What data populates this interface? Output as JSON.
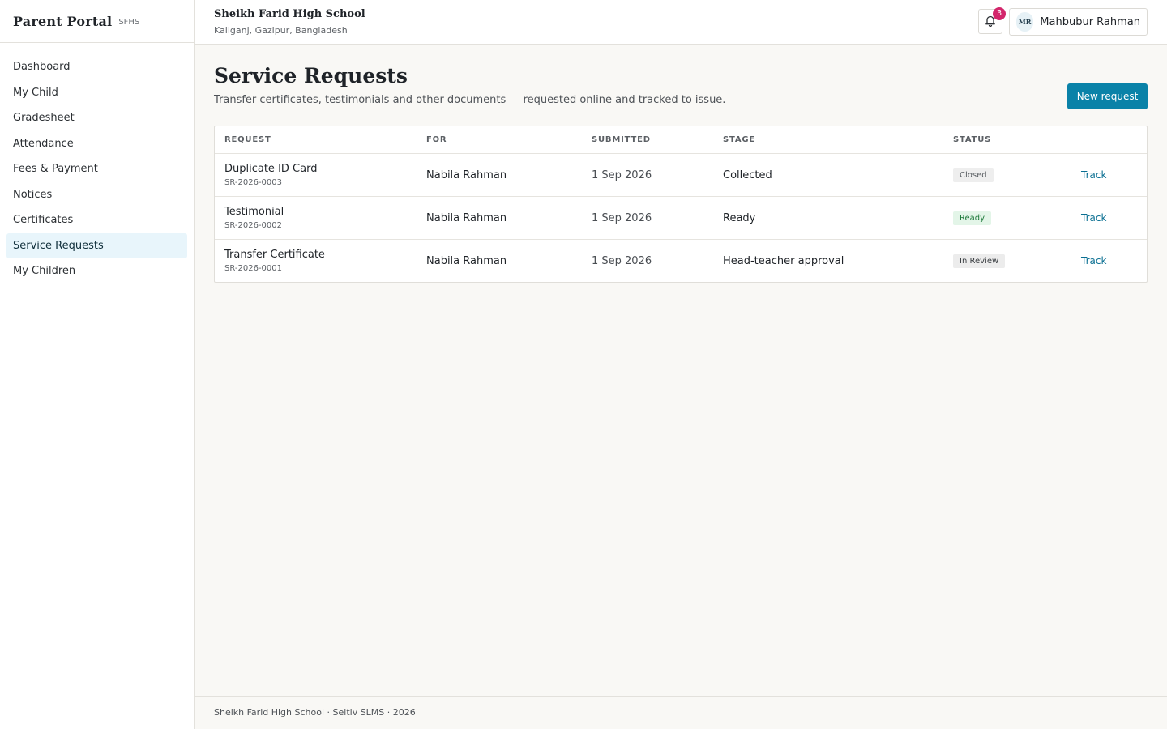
{
  "brand": {
    "title": "Parent Portal",
    "code": "SFHS"
  },
  "sidebar": {
    "items": [
      {
        "label": "Dashboard"
      },
      {
        "label": "My Child"
      },
      {
        "label": "Gradesheet"
      },
      {
        "label": "Attendance"
      },
      {
        "label": "Fees & Payment"
      },
      {
        "label": "Notices"
      },
      {
        "label": "Certificates"
      },
      {
        "label": "Service Requests",
        "active": true
      },
      {
        "label": "My Children"
      }
    ]
  },
  "header": {
    "school_name": "Sheikh Farid High School",
    "school_location": "Kaliganj, Gazipur, Bangladesh",
    "notification_count": "3",
    "user_initials": "MR",
    "user_name": "Mahbubur Rahman"
  },
  "page": {
    "title": "Service Requests",
    "subtitle": "Transfer certificates, testimonials and other documents — requested online and tracked to issue.",
    "new_request_label": "New request"
  },
  "table": {
    "columns": [
      "REQUEST",
      "FOR",
      "SUBMITTED",
      "STAGE",
      "STATUS"
    ],
    "rows": [
      {
        "request": "Duplicate ID Card",
        "id": "SR-2026-0003",
        "for": "Nabila Rahman",
        "submitted": "1 Sep 2026",
        "stage": "Collected",
        "status": "Closed",
        "action": "Track"
      },
      {
        "request": "Testimonial",
        "id": "SR-2026-0002",
        "for": "Nabila Rahman",
        "submitted": "1 Sep 2026",
        "stage": "Ready",
        "status": "Ready",
        "action": "Track"
      },
      {
        "request": "Transfer Certificate",
        "id": "SR-2026-0001",
        "for": "Nabila Rahman",
        "submitted": "1 Sep 2026",
        "stage": "Head-teacher approval",
        "status": "In Review",
        "action": "Track"
      }
    ]
  },
  "colors": {
    "primary": "#0a82a8",
    "active_nav_bg": "#e8f5fb",
    "badge_notification": "#d3266b",
    "status_ready": "#1f7a3c"
  },
  "icons": {
    "notifications": "bell-icon"
  },
  "footer": {
    "text": "Sheikh Farid High School · Seltiv SLMS · 2026"
  }
}
